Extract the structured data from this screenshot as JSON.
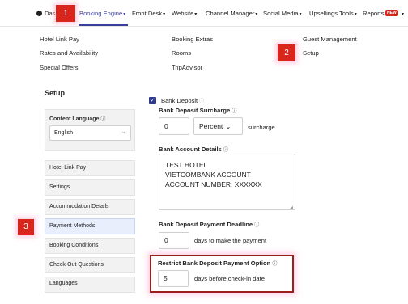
{
  "nav": {
    "items": [
      {
        "label": "Dash"
      },
      {
        "label": "Booking Engine"
      },
      {
        "label": "Front Desk"
      },
      {
        "label": "Website"
      },
      {
        "label": "Channel Manager"
      },
      {
        "label": "Social Media"
      },
      {
        "label": "Upsellings Tools"
      },
      {
        "label": "Reports"
      }
    ],
    "new_badge": "NEW",
    "accent": "#3b3f9c"
  },
  "markers": [
    "1",
    "2",
    "3"
  ],
  "menu": {
    "col1": [
      "Hotel Link Pay",
      "Rates and Availability",
      "Special Offers"
    ],
    "col2": [
      "Booking Extras",
      "Rooms",
      "TripAdvisor"
    ],
    "col3": [
      "Guest Management",
      "Setup"
    ]
  },
  "sidebar": {
    "title": "Setup",
    "content_language_label": "Content Language",
    "content_language_value": "English",
    "items": [
      {
        "label": "Hotel Link Pay"
      },
      {
        "label": "Settings"
      },
      {
        "label": "Accommodation Details"
      },
      {
        "label": "Payment Methods"
      },
      {
        "label": "Booking Conditions"
      },
      {
        "label": "Check-Out Questions"
      },
      {
        "label": "Languages"
      }
    ]
  },
  "form": {
    "bank_deposit_label": "Bank Deposit",
    "surcharge_label": "Bank Deposit Surcharge",
    "surcharge_value": "0",
    "surcharge_unit": "Percent",
    "surcharge_suffix": "surcharge",
    "account_details_label": "Bank Account Details",
    "account_lines": [
      "TEST HOTEL",
      "VIETCOMBANK ACCOUNT",
      "ACCOUNT NUMBER: XXXXXX"
    ],
    "deadline_label": "Bank Deposit Payment Deadline",
    "deadline_value": "0",
    "deadline_suffix": "days to make the payment",
    "restrict_label": "Restrict Bank Deposit Payment Option",
    "restrict_value": "5",
    "restrict_suffix": "days before check-in date"
  },
  "colors": {
    "marker": "#d9261c",
    "checkbox": "#2d3a8c",
    "highlight_border": "#9b1f1a"
  }
}
